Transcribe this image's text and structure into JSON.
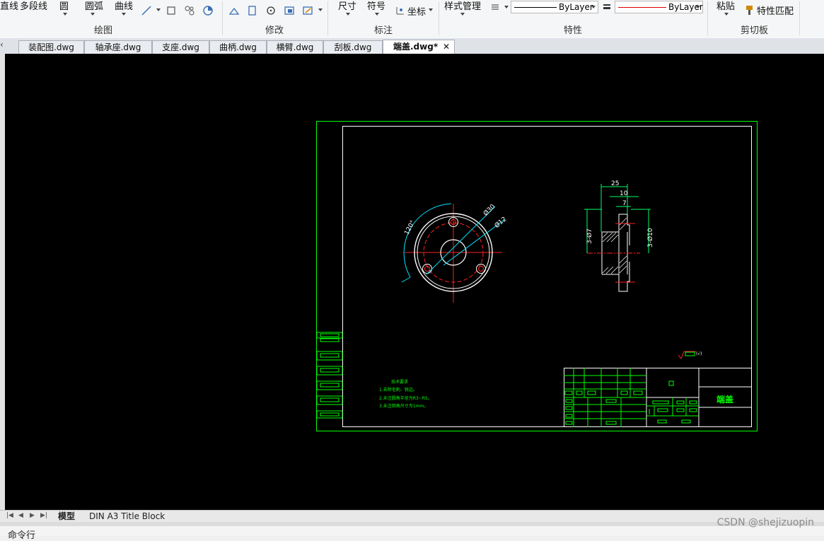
{
  "ribbon": {
    "draw": {
      "items": [
        "直线",
        "多段线",
        "圆",
        "圆弧",
        "曲线"
      ],
      "title": "绘图"
    },
    "modify": {
      "title": "修改"
    },
    "annotate": {
      "items": [
        "尺寸",
        "符号",
        "坐标"
      ],
      "title": "标注"
    },
    "properties": {
      "style_manager": "样式管理",
      "linetype_value": "ByLayer",
      "color_value": "ByLayer",
      "title": "特性"
    },
    "clipboard": {
      "paste": "粘贴",
      "match_props": "特性匹配",
      "title": "剪切板"
    }
  },
  "file_tabs": [
    {
      "label": "装配图.dwg"
    },
    {
      "label": "轴承座.dwg"
    },
    {
      "label": "支座.dwg"
    },
    {
      "label": "曲柄.dwg"
    },
    {
      "label": "横臂.dwg"
    },
    {
      "label": "刮板.dwg"
    },
    {
      "label": "端盖.dwg*"
    }
  ],
  "drawing": {
    "dims": {
      "angle": "120°",
      "d30": "Ø30",
      "d12": "Ø12",
      "w25": "25",
      "w10": "10",
      "w7": "7",
      "h47": "3-Ø7",
      "h10": "3-Ø10"
    },
    "notes": {
      "title": "技术要求",
      "l1": "1.去除毛刺、锐边。",
      "l2": "2.未注圆角半径为R3~R5。",
      "l3": "3.未注倒角尺寸为1mm。"
    },
    "title_name": "端盖",
    "roughness": "(√)"
  },
  "layout_tabs": [
    "模型",
    "DIN A3 Title Block"
  ],
  "command_label": "命令行",
  "watermark": "CSDN @shejizuopin",
  "colors": {
    "canvas": "#000000",
    "frame": "#00ff00",
    "center": "#ff0000",
    "dim": "#00ffff"
  }
}
